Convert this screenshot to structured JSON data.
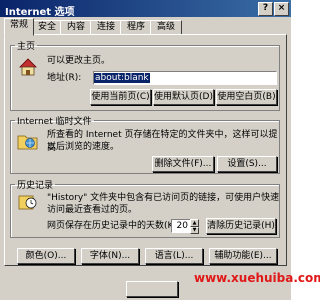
{
  "window": {
    "title": "Internet 选项",
    "help_btn": "?",
    "close_btn": "×"
  },
  "tabs": [
    "常规",
    "安全",
    "内容",
    "连接",
    "程序",
    "高级"
  ],
  "home": {
    "legend": "主页",
    "desc": "可以更改主页。",
    "address_label": "地址(R):",
    "address_value": "about:blank",
    "btn_current": "使用当前页(C)",
    "btn_default": "使用默认页(D)",
    "btn_blank": "使用空白页(B)"
  },
  "temp": {
    "legend": "Internet 临时文件",
    "desc_1": "所查看的 Internet 页存储在特定的文件夹中，这样可以提高",
    "desc_2": "以后浏览的速度。",
    "btn_delete": "删除文件(F)...",
    "btn_settings": "设置(S)..."
  },
  "history": {
    "legend": "历史记录",
    "desc_1": "\"History\" 文件夹中包含有已访问页的链接，可使用户快速",
    "desc_2": "访问最近查看过的页。",
    "days_label": "网页保存在历史记录中的天数(K):",
    "days_value": "20",
    "btn_clear": "清除历史记录(H)"
  },
  "bottom": {
    "btn_colors": "颜色(O)...",
    "btn_fonts": "字体(N)...",
    "btn_languages": "语言(L)...",
    "btn_access": "辅助功能(E)..."
  },
  "watermark": "www.xuehuiba.com"
}
